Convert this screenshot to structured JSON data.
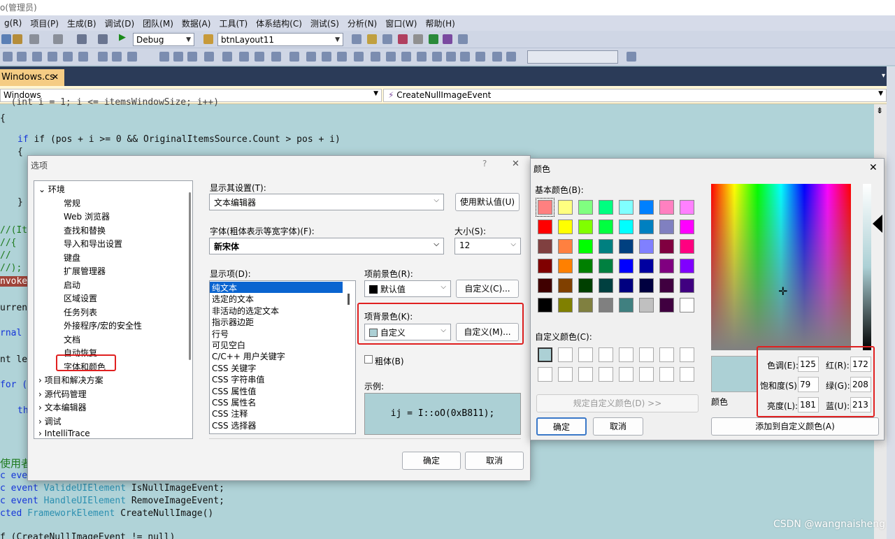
{
  "window": {
    "title": "o(管理员)"
  },
  "menu": [
    "g(R)",
    "项目(P)",
    "生成(B)",
    "调试(D)",
    "团队(M)",
    "数据(A)",
    "工具(T)",
    "体系结构(C)",
    "测试(S)",
    "分析(N)",
    "窗口(W)",
    "帮助(H)"
  ],
  "toolbar": {
    "config": "Debug",
    "target": "btnLayout11"
  },
  "tab": {
    "label": "Windows.cs",
    "close": "✕"
  },
  "nav": {
    "left": "Windows",
    "right": "CreateNullImageEvent"
  },
  "code": {
    "l1": "if (pos + i >= 0 && OriginalItemsSource.Count > pos + i)",
    "l2": "{",
    "l3": "}",
    "l4": "//(Ite",
    "l5": "//{",
    "l6": "//",
    "l7": "//);",
    "l8": "nvoke",
    "l9": "urren",
    "l10": "rnal v",
    "l11": "nt le",
    "l12": "for (i",
    "l13": "th",
    "l14": "使用者",
    "l15a": "c eve",
    "l16a": "c event",
    "l16b": "ValideUIElement",
    "l16c": "IsNullImageEvent;",
    "l17a": "c event",
    "l17b": "HandleUIElement",
    "l17c": "RemoveImageEvent;",
    "l18a": "cted",
    "l18b": "FrameworkElement",
    "l18c": "CreateNullImage()",
    "l19": "f (CreateNullImageEvent != null)"
  },
  "options": {
    "title": "选项",
    "help": "?",
    "close": "✕",
    "tree": [
      "环境",
      "常规",
      "Web 浏览器",
      "查找和替换",
      "导入和导出设置",
      "键盘",
      "扩展管理器",
      "启动",
      "区域设置",
      "任务列表",
      "外接程序/宏的安全性",
      "文档",
      "自动恢复",
      "字体和颜色",
      "项目和解决方案",
      "源代码管理",
      "文本编辑器",
      "调试",
      "IntelliTrace"
    ],
    "show_settings_label": "显示其设置(T):",
    "show_settings_value": "文本编辑器",
    "use_default": "使用默认值(U)",
    "font_label": "字体(粗体表示等宽字体)(F):",
    "font_value": "新宋体",
    "size_label": "大小(S):",
    "size_value": "12",
    "display_items_label": "显示项(D):",
    "items": [
      "纯文本",
      "选定的文本",
      "非活动的选定文本",
      "指示器边距",
      "行号",
      "可见空白",
      "C/C++ 用户关键字",
      "CSS 关键字",
      "CSS 字符串值",
      "CSS 属性值",
      "CSS 属性名",
      "CSS 注释",
      "CSS 选择器"
    ],
    "fg_label": "项前景色(R):",
    "fg_value": "默认值",
    "fg_custom": "自定义(C)...",
    "bg_label": "项背景色(K):",
    "bg_value": "自定义",
    "bg_custom": "自定义(M)...",
    "bold": "粗体(B)",
    "sample_label": "示例:",
    "sample_text": "ij = I::oO(0xB811);",
    "ok": "确定",
    "cancel": "取消"
  },
  "colors": {
    "title": "颜色",
    "close": "✕",
    "basic_label": "基本颜色(B):",
    "basic": [
      "#ff8080",
      "#ffff80",
      "#80ff80",
      "#00ff80",
      "#80ffff",
      "#0080ff",
      "#ff80c0",
      "#ff80ff",
      "#ff0000",
      "#ffff00",
      "#80ff00",
      "#00ff40",
      "#00ffff",
      "#0080c0",
      "#8080c0",
      "#ff00ff",
      "#804040",
      "#ff8040",
      "#00ff00",
      "#008080",
      "#004080",
      "#8080ff",
      "#800040",
      "#ff0080",
      "#800000",
      "#ff8000",
      "#008000",
      "#008040",
      "#0000ff",
      "#0000a0",
      "#800080",
      "#8000ff",
      "#400000",
      "#804000",
      "#004000",
      "#004040",
      "#000080",
      "#000040",
      "#400040",
      "#400080",
      "#000000",
      "#808000",
      "#808040",
      "#808080",
      "#408080",
      "#c0c0c0",
      "#400040",
      "#ffffff"
    ],
    "custom_label": "自定义颜色(C):",
    "define_custom": "规定自定义颜色(D) >>",
    "ok": "确定",
    "cancel": "取消",
    "swatch_label": "颜色",
    "hue_label": "色调(E):",
    "hue": "125",
    "sat_label": "饱和度(S):",
    "sat": "79",
    "lum_label": "亮度(L):",
    "lum": "181",
    "red_label": "红(R):",
    "red": "172",
    "green_label": "绿(G):",
    "green": "208",
    "blue_label": "蓝(U):",
    "blue": "213",
    "add_custom": "添加到自定义颜色(A)",
    "current": "#acd0d5"
  },
  "watermark": "CSDN @wangnaisheng"
}
